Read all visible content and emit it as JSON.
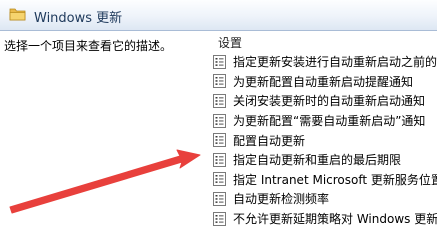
{
  "header": {
    "title": "Windows 更新"
  },
  "left_pane": {
    "description": "选择一个项目来查看它的描述。"
  },
  "right_pane": {
    "column_header": "设置",
    "items": [
      {
        "label": "指定更新安装进行自动重新启动之前的"
      },
      {
        "label": "为更新配置自动重新启动提醒通知"
      },
      {
        "label": "关闭安装更新时的自动重新启动通知"
      },
      {
        "label": "为更新配置“需要自动重新启动”通知"
      },
      {
        "label": "配置自动更新"
      },
      {
        "label": "指定自动更新和重启的最后期限"
      },
      {
        "label": "指定 Intranet Microsoft 更新服务位置"
      },
      {
        "label": "自动更新检测频率"
      },
      {
        "label": "不允许更新延期策略对 Windows 更新"
      }
    ]
  },
  "colors": {
    "arrow": "#e8403c",
    "header_text": "#1e395b"
  },
  "icons": {
    "header": "folder-icon",
    "item": "policy-setting-icon"
  }
}
